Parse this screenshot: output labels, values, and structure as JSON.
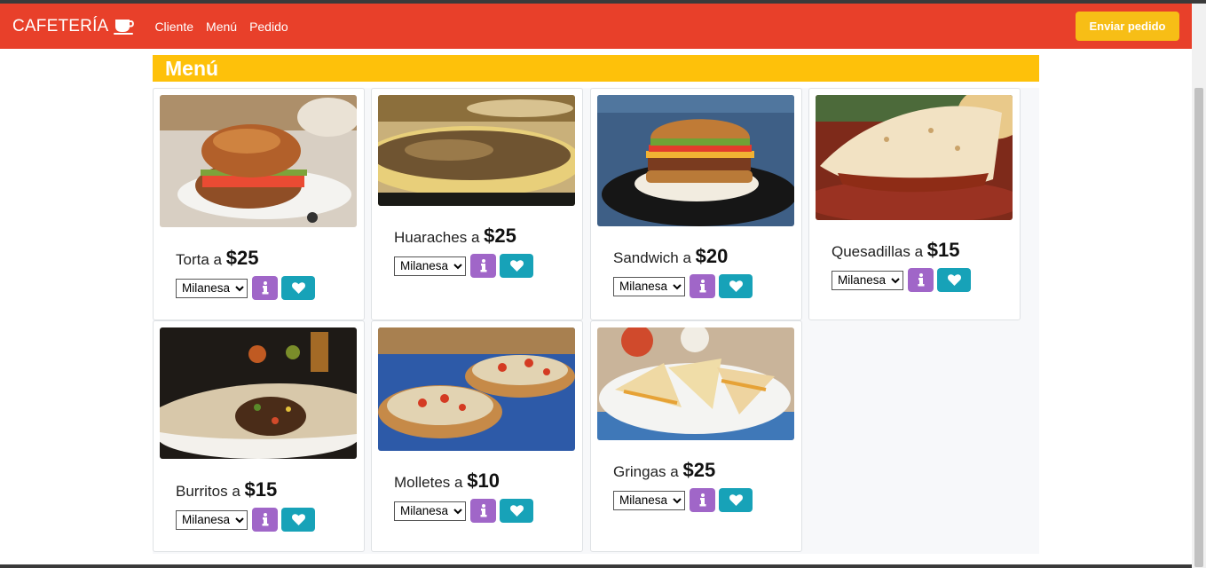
{
  "navbar": {
    "brand": "CAFETERÍA",
    "links": [
      "Cliente",
      "Menú",
      "Pedido"
    ],
    "send_label": "Enviar pedido",
    "color": "#e8402a"
  },
  "menu": {
    "title": "Menú",
    "connector": "a",
    "items": [
      {
        "name": "Torta",
        "price": "$25",
        "option": "Milanesa",
        "image": "torta-image"
      },
      {
        "name": "Huaraches",
        "price": "$25",
        "option": "Milanesa",
        "image": "huaraches-image"
      },
      {
        "name": "Sandwich",
        "price": "$20",
        "option": "Milanesa",
        "image": "sandwich-image"
      },
      {
        "name": "Quesadillas",
        "price": "$15",
        "option": "Milanesa",
        "image": "quesadillas-image"
      },
      {
        "name": "Burritos",
        "price": "$15",
        "option": "Milanesa",
        "image": "burritos-image"
      },
      {
        "name": "Molletes",
        "price": "$10",
        "option": "Milanesa",
        "image": "molletes-image"
      },
      {
        "name": "Gringas",
        "price": "$25",
        "option": "Milanesa",
        "image": "gringas-image"
      }
    ]
  },
  "colors": {
    "accent": "#fec10a",
    "send_button": "#f7be16",
    "info_button": "#a066c8",
    "like_button": "#17a2b8"
  },
  "icons": {
    "brand": "coffee-cup-icon",
    "info": "info-icon",
    "like": "heart-icon"
  }
}
